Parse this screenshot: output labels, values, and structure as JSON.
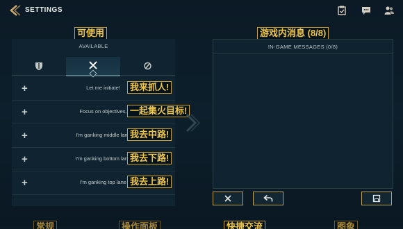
{
  "header": {
    "title": "SETTINGS"
  },
  "annotations": {
    "left_panel": "可使用",
    "right_panel": "游戏内消息 (8/8)",
    "rows": [
      "我来抓人!",
      "一起集火目标!",
      "我去中路!",
      "我去下路!",
      "我去上路!"
    ],
    "bottom": [
      "常规",
      "操作面板",
      "快捷交流",
      "图象"
    ]
  },
  "left_panel": {
    "title": "AVAILABLE",
    "tabs": [
      "shield-icon",
      "crossed-swords-icon",
      "ping-icon"
    ],
    "rows": [
      {
        "label": "Let me initiate!"
      },
      {
        "label": "Focus on objectives."
      },
      {
        "label": "I'm ganking middle lane"
      },
      {
        "label": "I'm ganking bottom lane"
      },
      {
        "label": "I'm ganking top lane"
      }
    ]
  },
  "right_panel": {
    "title": "IN-GAME MESSAGES (0/8)"
  },
  "buttons": {
    "clear": "close-icon",
    "undo": "undo-icon",
    "save": "save-icon"
  },
  "colors": {
    "accent_gold": "#c9a23c",
    "background": "#0b1a25"
  }
}
